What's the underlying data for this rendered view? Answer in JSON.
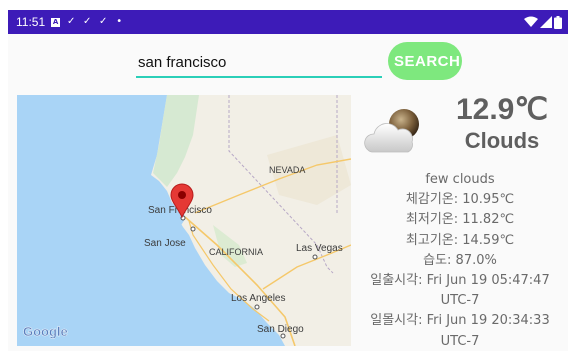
{
  "status_bar": {
    "time": "11:51",
    "notif_a": "A",
    "notif_check": "✓",
    "notif_dot": "•"
  },
  "search": {
    "value": "san francisco",
    "button_label": "SEARCH"
  },
  "map": {
    "labels": {
      "nevada": "NEVADA",
      "san_francisco": "San Francisco",
      "san_jose": "San Jose",
      "california": "CALIFORNIA",
      "las_vegas": "Las Vegas",
      "los_angeles": "Los Angeles",
      "san_diego": "San Diego"
    },
    "logo": "Google"
  },
  "weather": {
    "temperature": "12.9℃",
    "main": "Clouds",
    "description": "few clouds",
    "feels_like": "체감기온: 10.95℃",
    "temp_min": "최저기온: 11.82℃",
    "temp_max": "최고기온: 14.59℃",
    "humidity": "습도: 87.0%",
    "sunrise_line1": "일출시각: Fri Jun 19 05:47:47",
    "sunrise_line2": "UTC-7",
    "sunset_line1": "일몰시각: Fri Jun 19 20:34:33",
    "sunset_line2": "UTC-7"
  },
  "colors": {
    "status_bar": "#3d1bb8",
    "search_button": "#7ee87e",
    "input_underline": "#2bcfb8",
    "map_water": "#a9d4f6",
    "map_land": "#f2efe6",
    "marker": "#e53935"
  }
}
